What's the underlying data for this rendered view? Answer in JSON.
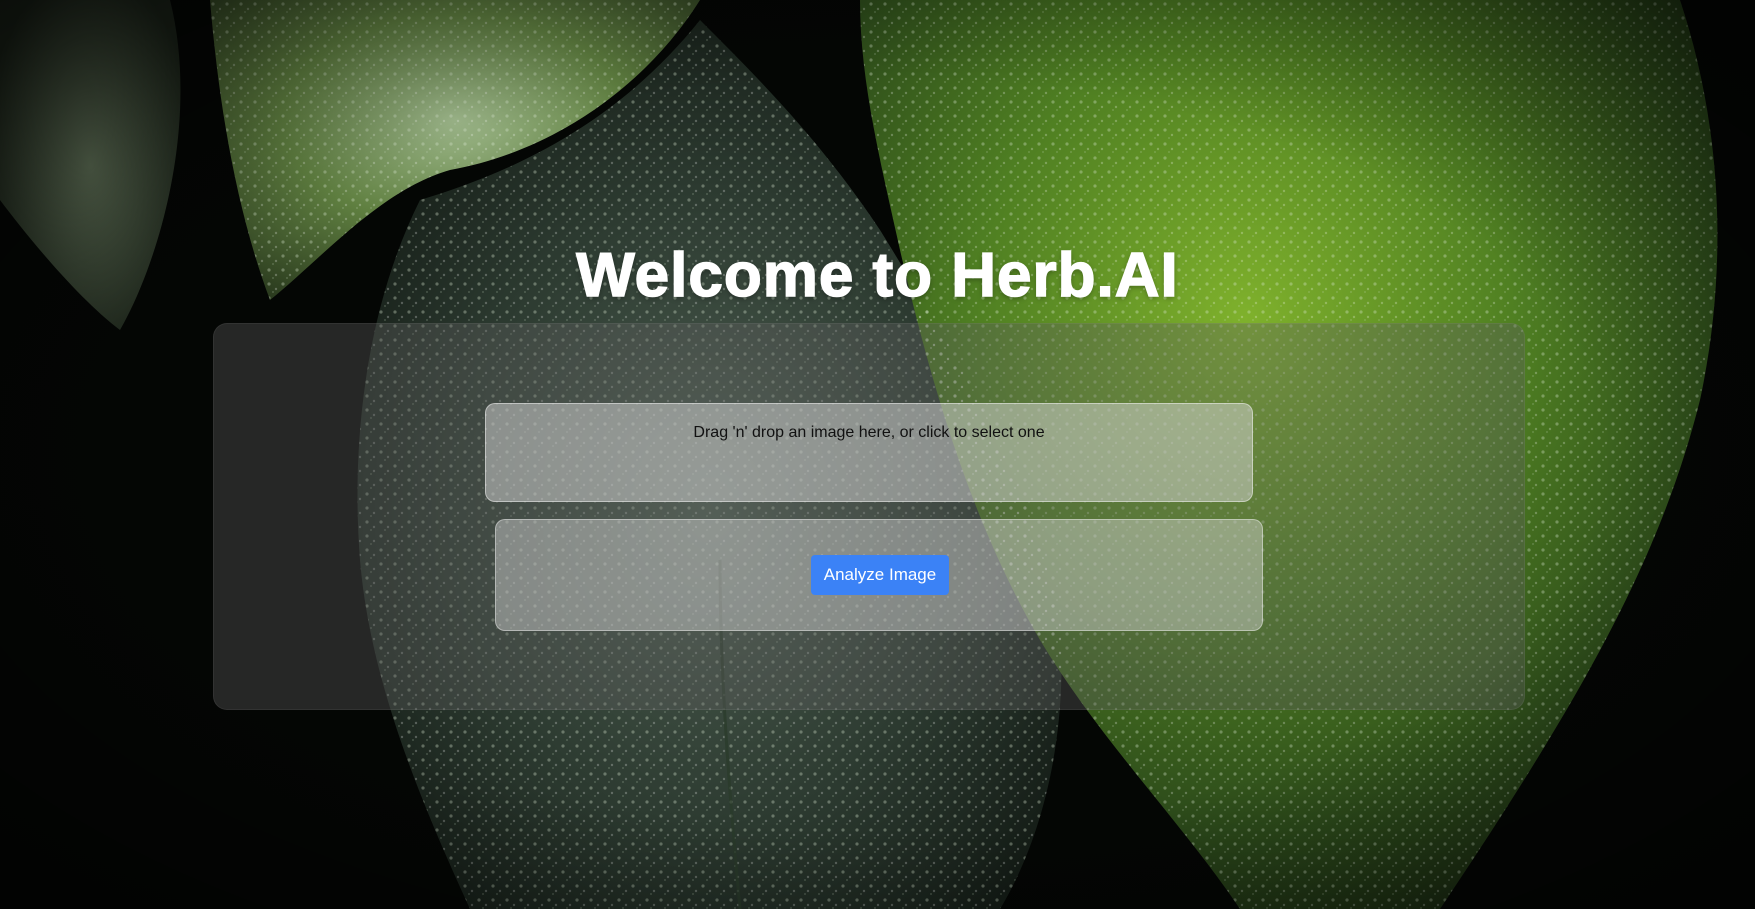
{
  "page": {
    "title": "Welcome to Herb.AI"
  },
  "upload": {
    "dropzone_text": "Drag 'n' drop an image here, or click to select one"
  },
  "actions": {
    "analyze_label": "Analyze Image",
    "analyze_color": "#3b82f6"
  },
  "background": {
    "subject": "dark green dew-covered leaves"
  }
}
